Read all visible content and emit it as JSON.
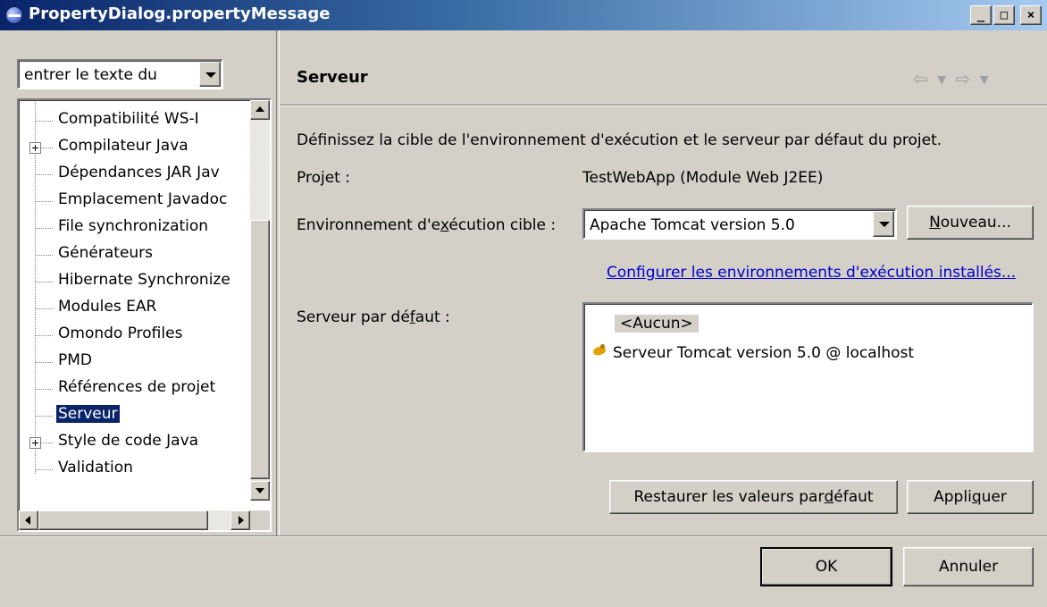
{
  "window": {
    "title": "PropertyDialog.propertyMessage",
    "controls": {
      "minimize": "_",
      "maximize": "□",
      "close": "×"
    }
  },
  "filter": {
    "value": "entrer le texte du"
  },
  "tree": {
    "items": [
      {
        "label": "Compatibilité WS-I",
        "expandable": false
      },
      {
        "label": "Compilateur Java",
        "expandable": true
      },
      {
        "label": "Dépendances JAR Jav",
        "expandable": false
      },
      {
        "label": "Emplacement Javadoc",
        "expandable": false
      },
      {
        "label": "File synchronization",
        "expandable": false
      },
      {
        "label": "Générateurs",
        "expandable": false
      },
      {
        "label": "Hibernate Synchronize",
        "expandable": false
      },
      {
        "label": "Modules EAR",
        "expandable": false
      },
      {
        "label": "Omondo Profiles",
        "expandable": false
      },
      {
        "label": "PMD",
        "expandable": false
      },
      {
        "label": "Références de projet",
        "expandable": false
      },
      {
        "label": "Serveur",
        "expandable": false,
        "selected": true
      },
      {
        "label": "Style de code Java",
        "expandable": true
      },
      {
        "label": "Validation",
        "expandable": false
      }
    ]
  },
  "page": {
    "title": "Serveur",
    "nav": {
      "back": "⇦ ▾",
      "forward": "⇨ ▾"
    },
    "description": "Définissez la cible de l'environnement d'exécution et le serveur par défaut du projet.",
    "project_label": "Projet :",
    "project_value": "TestWebApp (Module Web J2EE)",
    "runtime_label_pre": "Environnement d'e",
    "runtime_label_mnemonic": "x",
    "runtime_label_post": "écution cible :",
    "runtime_value": "Apache Tomcat version 5.0",
    "new_button_mnemonic": "N",
    "new_button_rest": "ouveau...",
    "config_link_pre": "Confi",
    "config_link_mnemonic": "g",
    "config_link_post": "urer les environnements d'exécution installés...",
    "default_server_label_pre": "Serveur par dé",
    "default_server_label_mnemonic": "f",
    "default_server_label_post": "aut :",
    "servers": [
      "<Aucun>",
      "Serveur Tomcat version 5.0 @ localhost"
    ],
    "restore_button_pre": "Restaurer les valeurs par ",
    "restore_button_mnemonic": "d",
    "restore_button_post": "éfaut",
    "apply_button_pre": "Appli",
    "apply_button_mnemonic": "q",
    "apply_button_post": "uer"
  },
  "footer": {
    "ok_label": "OK",
    "cancel_label": "Annuler"
  }
}
